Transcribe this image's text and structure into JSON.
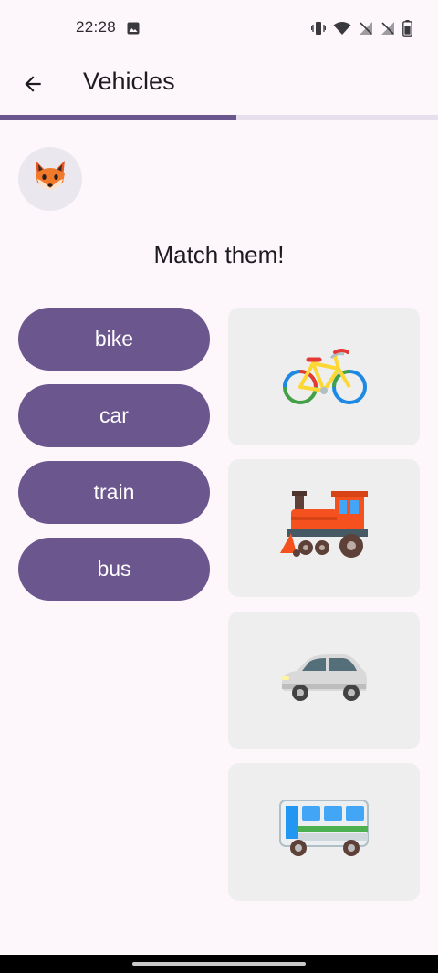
{
  "status_bar": {
    "time": "22:28",
    "icons": [
      "image-icon",
      "vibrate-icon",
      "wifi-icon",
      "no-signal-icon",
      "no-signal-icon",
      "battery-icon"
    ]
  },
  "app_bar": {
    "title": "Vehicles",
    "back_icon": "arrow-back-icon"
  },
  "progress": {
    "value": 0.54,
    "color": "#6b568e"
  },
  "avatar": {
    "icon": "fox-icon"
  },
  "prompt": "Match them!",
  "words": [
    {
      "label": "bike"
    },
    {
      "label": "car"
    },
    {
      "label": "train"
    },
    {
      "label": "bus"
    }
  ],
  "pictures": [
    {
      "icon": "bicycle-icon"
    },
    {
      "icon": "locomotive-icon"
    },
    {
      "icon": "car-icon"
    },
    {
      "icon": "bus-icon"
    }
  ],
  "colors": {
    "accent": "#6b568e",
    "background": "#fdf7fc",
    "card": "#eeeeee"
  }
}
